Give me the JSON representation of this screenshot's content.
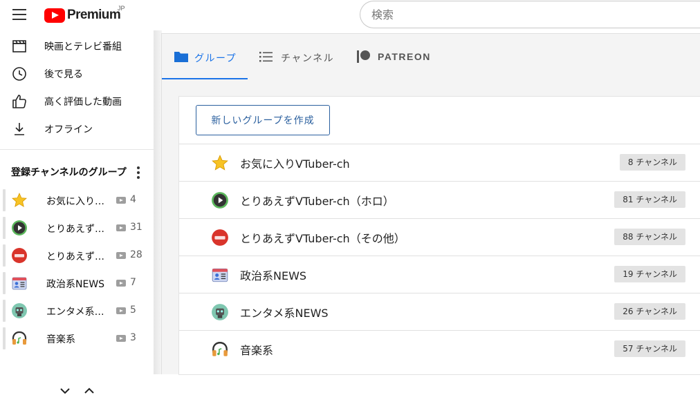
{
  "header": {
    "menu_icon": "hamburger-menu-icon",
    "logo_text": "Premium",
    "country_code": "JP",
    "search_placeholder": "検索"
  },
  "sidebar": {
    "nav_items": [
      {
        "label": "映画とテレビ番組",
        "icon": "clapperboard-icon"
      },
      {
        "label": "後で見る",
        "icon": "clock-icon"
      },
      {
        "label": "高く評価した動画",
        "icon": "thumbs-up-icon"
      },
      {
        "label": "オフライン",
        "icon": "download-icon"
      }
    ],
    "groups_header": "登録チャンネルのグループ",
    "groups": [
      {
        "name": "お気に入りVTuber-ch",
        "count": "4",
        "icon": "star-icon"
      },
      {
        "name": "とりあえずVTuber-ch（ホロ）",
        "count": "31",
        "icon": "play-circle-icon"
      },
      {
        "name": "とりあえずVTuber-ch（その他）",
        "count": "28",
        "icon": "vlog-icon"
      },
      {
        "name": "政治系NEWS",
        "count": "7",
        "icon": "id-badge-icon"
      },
      {
        "name": "エンタメ系NEWS",
        "count": "5",
        "icon": "robot-icon"
      },
      {
        "name": "音楽系",
        "count": "3",
        "icon": "headphones-icon"
      }
    ]
  },
  "tabs": [
    {
      "label": "グループ",
      "icon": "folder-icon",
      "active": true
    },
    {
      "label": "チャンネル",
      "icon": "list-icon",
      "active": false
    },
    {
      "label": "PATREON",
      "icon": "patreon-icon",
      "active": false
    }
  ],
  "main": {
    "new_group_label": "新しいグループを作成",
    "groups": [
      {
        "name": "お気に入りVTuber-ch",
        "badge": "8 チャンネル",
        "icon": "star-icon"
      },
      {
        "name": "とりあえずVTuber-ch（ホロ）",
        "badge": "81 チャンネル",
        "icon": "play-circle-icon"
      },
      {
        "name": "とりあえずVTuber-ch（その他）",
        "badge": "88 チャンネル",
        "icon": "vlog-icon"
      },
      {
        "name": "政治系NEWS",
        "badge": "19 チャンネル",
        "icon": "id-badge-icon"
      },
      {
        "name": "エンタメ系NEWS",
        "badge": "26 チャンネル",
        "icon": "robot-icon"
      },
      {
        "name": "音楽系",
        "badge": "57 チャンネル",
        "icon": "headphones-icon"
      }
    ]
  },
  "colors": {
    "brand_red": "#ff0000",
    "accent_blue": "#1a73e8",
    "button_blue": "#2a5f9e",
    "badge_bg": "#e3e3e3"
  }
}
